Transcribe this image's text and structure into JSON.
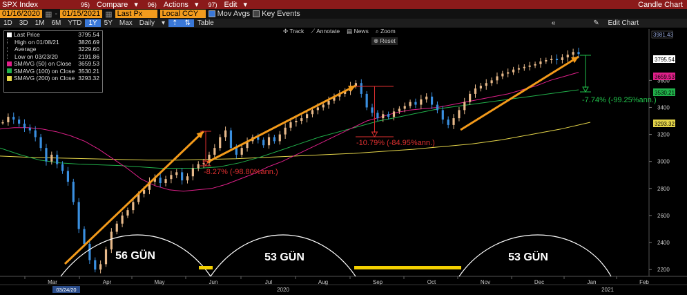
{
  "topbar": {
    "ticker": "SPX Index",
    "compare_num": "95)",
    "compare": "Compare",
    "actions_num": "96)",
    "actions": "Actions",
    "edit_num": "97)",
    "edit": "Edit",
    "chart_kind": "Candle Chart"
  },
  "toolbar": {
    "start_date": "01/16/2020",
    "end_date": "01/15/2021",
    "price_field": "Last Px",
    "currency": "Local CCY",
    "mov_avgs": "Mov Avgs",
    "key_events": "Key Events"
  },
  "periods": [
    "1D",
    "3D",
    "1M",
    "6M",
    "YTD",
    "1Y",
    "5Y",
    "Max"
  ],
  "selected_period": "1Y",
  "frequency": "Daily",
  "table_label": "Table",
  "edit_chart": "Edit Chart",
  "tools": {
    "track": "Track",
    "annotate": "Annotate",
    "news": "News",
    "zoom": "Zoom",
    "reset": "Reset"
  },
  "legend": [
    {
      "label": "Last Price",
      "value": "3795.54",
      "color": "#ffffff"
    },
    {
      "label": "High on 01/08/21",
      "value": "3826.69",
      "color": ""
    },
    {
      "label": "Average",
      "value": "3229.60",
      "color": ""
    },
    {
      "label": "Low on 03/23/20",
      "value": "2191.86",
      "color": ""
    },
    {
      "label": "SMAVG (50)  on Close",
      "value": "3659.53",
      "color": "#e0208a"
    },
    {
      "label": "SMAVG (100)  on Close",
      "value": "3530.21",
      "color": "#21b14b"
    },
    {
      "label": "SMAVG (200)  on Close",
      "value": "3293.32",
      "color": "#e6d64a"
    }
  ],
  "chart_data": {
    "type": "line",
    "ylim": [
      2150,
      3980
    ],
    "y_ticks": [
      2200,
      2400,
      2600,
      2800,
      3000,
      3200,
      3400,
      3600
    ],
    "x_labels": [
      "Mar",
      "Apr",
      "May",
      "Jun",
      "Jul",
      "Aug",
      "Sep",
      "Oct",
      "Nov",
      "Dec",
      "Jan",
      "Feb"
    ],
    "year_labels": [
      "2020",
      "2021"
    ],
    "low_date_label": "03/24/20",
    "top_value": "3981.43",
    "price": [
      3290,
      3330,
      3310,
      3280,
      3250,
      3230,
      3180,
      3100,
      3000,
      3050,
      2980,
      2930,
      2850,
      2700,
      2500,
      2390,
      2270,
      2200,
      2240,
      2350,
      2480,
      2540,
      2600,
      2640,
      2700,
      2760,
      2790,
      2850,
      2880,
      2840,
      2870,
      2900,
      2920,
      2860,
      2890,
      2950,
      2980,
      2990,
      3050,
      3100,
      3180,
      3230,
      3100,
      3050,
      3100,
      3150,
      3180,
      3160,
      3120,
      3180,
      3150,
      3200,
      3250,
      3290,
      3300,
      3320,
      3350,
      3380,
      3400,
      3420,
      3450,
      3480,
      3500,
      3520,
      3560,
      3580,
      3500,
      3400,
      3360,
      3320,
      3350,
      3330,
      3370,
      3390,
      3410,
      3440,
      3420,
      3460,
      3480,
      3420,
      3380,
      3310,
      3270,
      3320,
      3380,
      3440,
      3500,
      3540,
      3560,
      3580,
      3600,
      3630,
      3650,
      3660,
      3680,
      3690,
      3700,
      3710,
      3720,
      3740,
      3750,
      3760,
      3750,
      3770,
      3790,
      3810,
      3795
    ],
    "series": [
      {
        "name": "SMAVG (50)",
        "color": "#e0208a",
        "values": [
          3240,
          3250,
          3250,
          3240,
          3220,
          3190,
          3150,
          3090,
          3020,
          2950,
          2870,
          2820,
          2790,
          2780,
          2790,
          2800,
          2830,
          2870,
          2910,
          2960,
          3000,
          3050,
          3100,
          3150,
          3200,
          3250,
          3300,
          3330,
          3360,
          3380,
          3390,
          3400,
          3420,
          3440,
          3460,
          3480,
          3500,
          3530,
          3560,
          3600,
          3630,
          3660
        ]
      },
      {
        "name": "SMAVG (100)",
        "color": "#21b14b",
        "values": [
          3100,
          3050,
          3010,
          2990,
          2980,
          2975,
          2970,
          2960,
          2950,
          2950,
          2950,
          2960,
          2990,
          3030,
          3080,
          3130,
          3180,
          3220,
          3260,
          3300,
          3330,
          3360,
          3390,
          3410,
          3430,
          3450,
          3470,
          3490,
          3510,
          3530
        ]
      },
      {
        "name": "SMAVG (200)",
        "color": "#e6d64a",
        "values": [
          3040,
          3030,
          3025,
          3020,
          3015,
          3010,
          3010,
          3015,
          3020,
          3030,
          3040,
          3050,
          3060,
          3075,
          3090,
          3110,
          3130,
          3160,
          3200,
          3240,
          3290
        ]
      }
    ],
    "annotations": [
      {
        "text": "-8.27% (-98.80%ann.)",
        "color": "#e03030"
      },
      {
        "text": "-10.79% (-84.95%ann.)",
        "color": "#e03030"
      },
      {
        "text": "-7.74% (-99.25%ann.)",
        "color": "#21c14b"
      }
    ],
    "arc_labels": [
      "56 GÜN",
      "53 GÜN",
      "53 GÜN"
    ],
    "right_tags": [
      {
        "value": "3795.54",
        "color": "#ffffff",
        "text_color": "#000000"
      },
      {
        "value": "3659.53",
        "color": "#e0208a",
        "text_color": "#000000"
      },
      {
        "value": "3530.21",
        "color": "#21b14b",
        "text_color": "#000000"
      },
      {
        "value": "3293.32",
        "color": "#e6d64a",
        "text_color": "#000000"
      }
    ]
  }
}
